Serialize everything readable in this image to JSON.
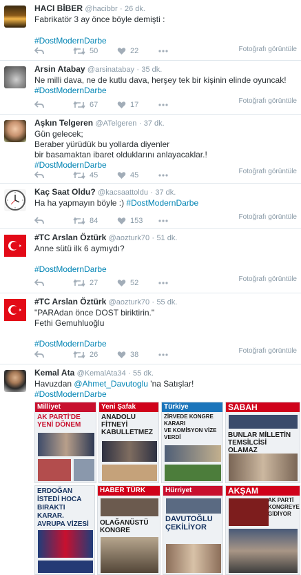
{
  "colors": {
    "link": "#0084b4",
    "muted": "#8899a6",
    "icon": "#a2adb8",
    "border": "#e1e8ed"
  },
  "photo_label": "Fotoğrafı görüntüle",
  "tweets": [
    {
      "name": "HACI BİBER",
      "handle": "@hacibbr",
      "time": "26 dk.",
      "text": "Fabrikatör 3 ay önce böyle demişti :",
      "hashtag": "#DostModernDarbe",
      "retweets": "50",
      "likes": "22"
    },
    {
      "name": "Arsin Atabay",
      "handle": "@arsinatabay",
      "time": "35 dk.",
      "text": "Ne milli dava, ne de kutlu dava, herşey tek bir kişinin elinde oyuncak!",
      "hashtag": "#DostModernDarbe",
      "retweets": "67",
      "likes": "17"
    },
    {
      "name": "Aşkın Telgeren",
      "handle": "@ATelgeren",
      "time": "37 dk.",
      "text": "Gün gelecek;\nBeraber yürüdük bu yollarda diyenler\nbir basamaktan ibaret olduklarını anlayacaklar.!",
      "hashtag": "#DostModernDarbe",
      "retweets": "45",
      "likes": "45"
    },
    {
      "name": "Kaç Saat Oldu?",
      "handle": "@kacsaattoldu",
      "time": "37 dk.",
      "text": "Ha ha yapmayın böyle :)",
      "hashtag": "#DostModernDarbe",
      "retweets": "84",
      "likes": "153"
    },
    {
      "name": "#TC Arslan Öztürk",
      "handle": "@aozturk70",
      "time": "51 dk.",
      "text": "Anne sütü ilk 6 aymıydı?",
      "hashtag": "#DostModernDarbe",
      "retweets": "27",
      "likes": "52"
    },
    {
      "name": "#TC Arslan Öztürk",
      "handle": "@aozturk70",
      "time": "55 dk.",
      "text": "\"PARAdan önce DOST biriktirin.\"\nFethi Gemuhluoğlu",
      "hashtag": "#DostModernDarbe",
      "retweets": "26",
      "likes": "38"
    },
    {
      "name": "Kemal Ata",
      "handle": "@KemalAta34",
      "time": "55 dk.",
      "text_pre": "Havuzdan ",
      "mention": "@Ahmet_Davutoglu",
      "text_post": " 'na Satışlar!",
      "hashtag": "#DostModernDarbe"
    }
  ],
  "newspapers": [
    {
      "masthead": "Milliyet",
      "headline": "AK PARTİ'DE YENİ DÖNEM",
      "color": "#c8102e"
    },
    {
      "masthead": "Yeni Şafak",
      "headline": "ANADOLU FİTNEYİ KABULLETMEZ",
      "color": "#d0021b"
    },
    {
      "masthead": "Türkiye",
      "headline": "ZİRVEDE KONGRE KARARI\nVE KOMİSYON VİZE VERDİ",
      "color": "#1b75bb"
    },
    {
      "masthead": "SABAH",
      "headline": "BUNLAR MİLLETİN TEMSİLCİSİ OLAMAZ",
      "color": "#d0021b"
    },
    {
      "masthead": "",
      "headline": "ERDOĞAN İSTEDİ HOCA BIRAKTI\nKARAR.\nAVRUPA VİZESİ",
      "color": "#1b75bb"
    },
    {
      "masthead": "HABER TÜRK",
      "headline": "OLAĞANÜSTÜ KONGRE",
      "color": "#d0021b"
    },
    {
      "masthead": "Hürriyet",
      "headline": "DAVUTOĞLU ÇEKİLİYOR",
      "color": "#c8102e"
    },
    {
      "masthead": "AKŞAM",
      "headline": "AK PARTİ KONGREYE GİDİYOR",
      "color": "#d0021b"
    }
  ]
}
